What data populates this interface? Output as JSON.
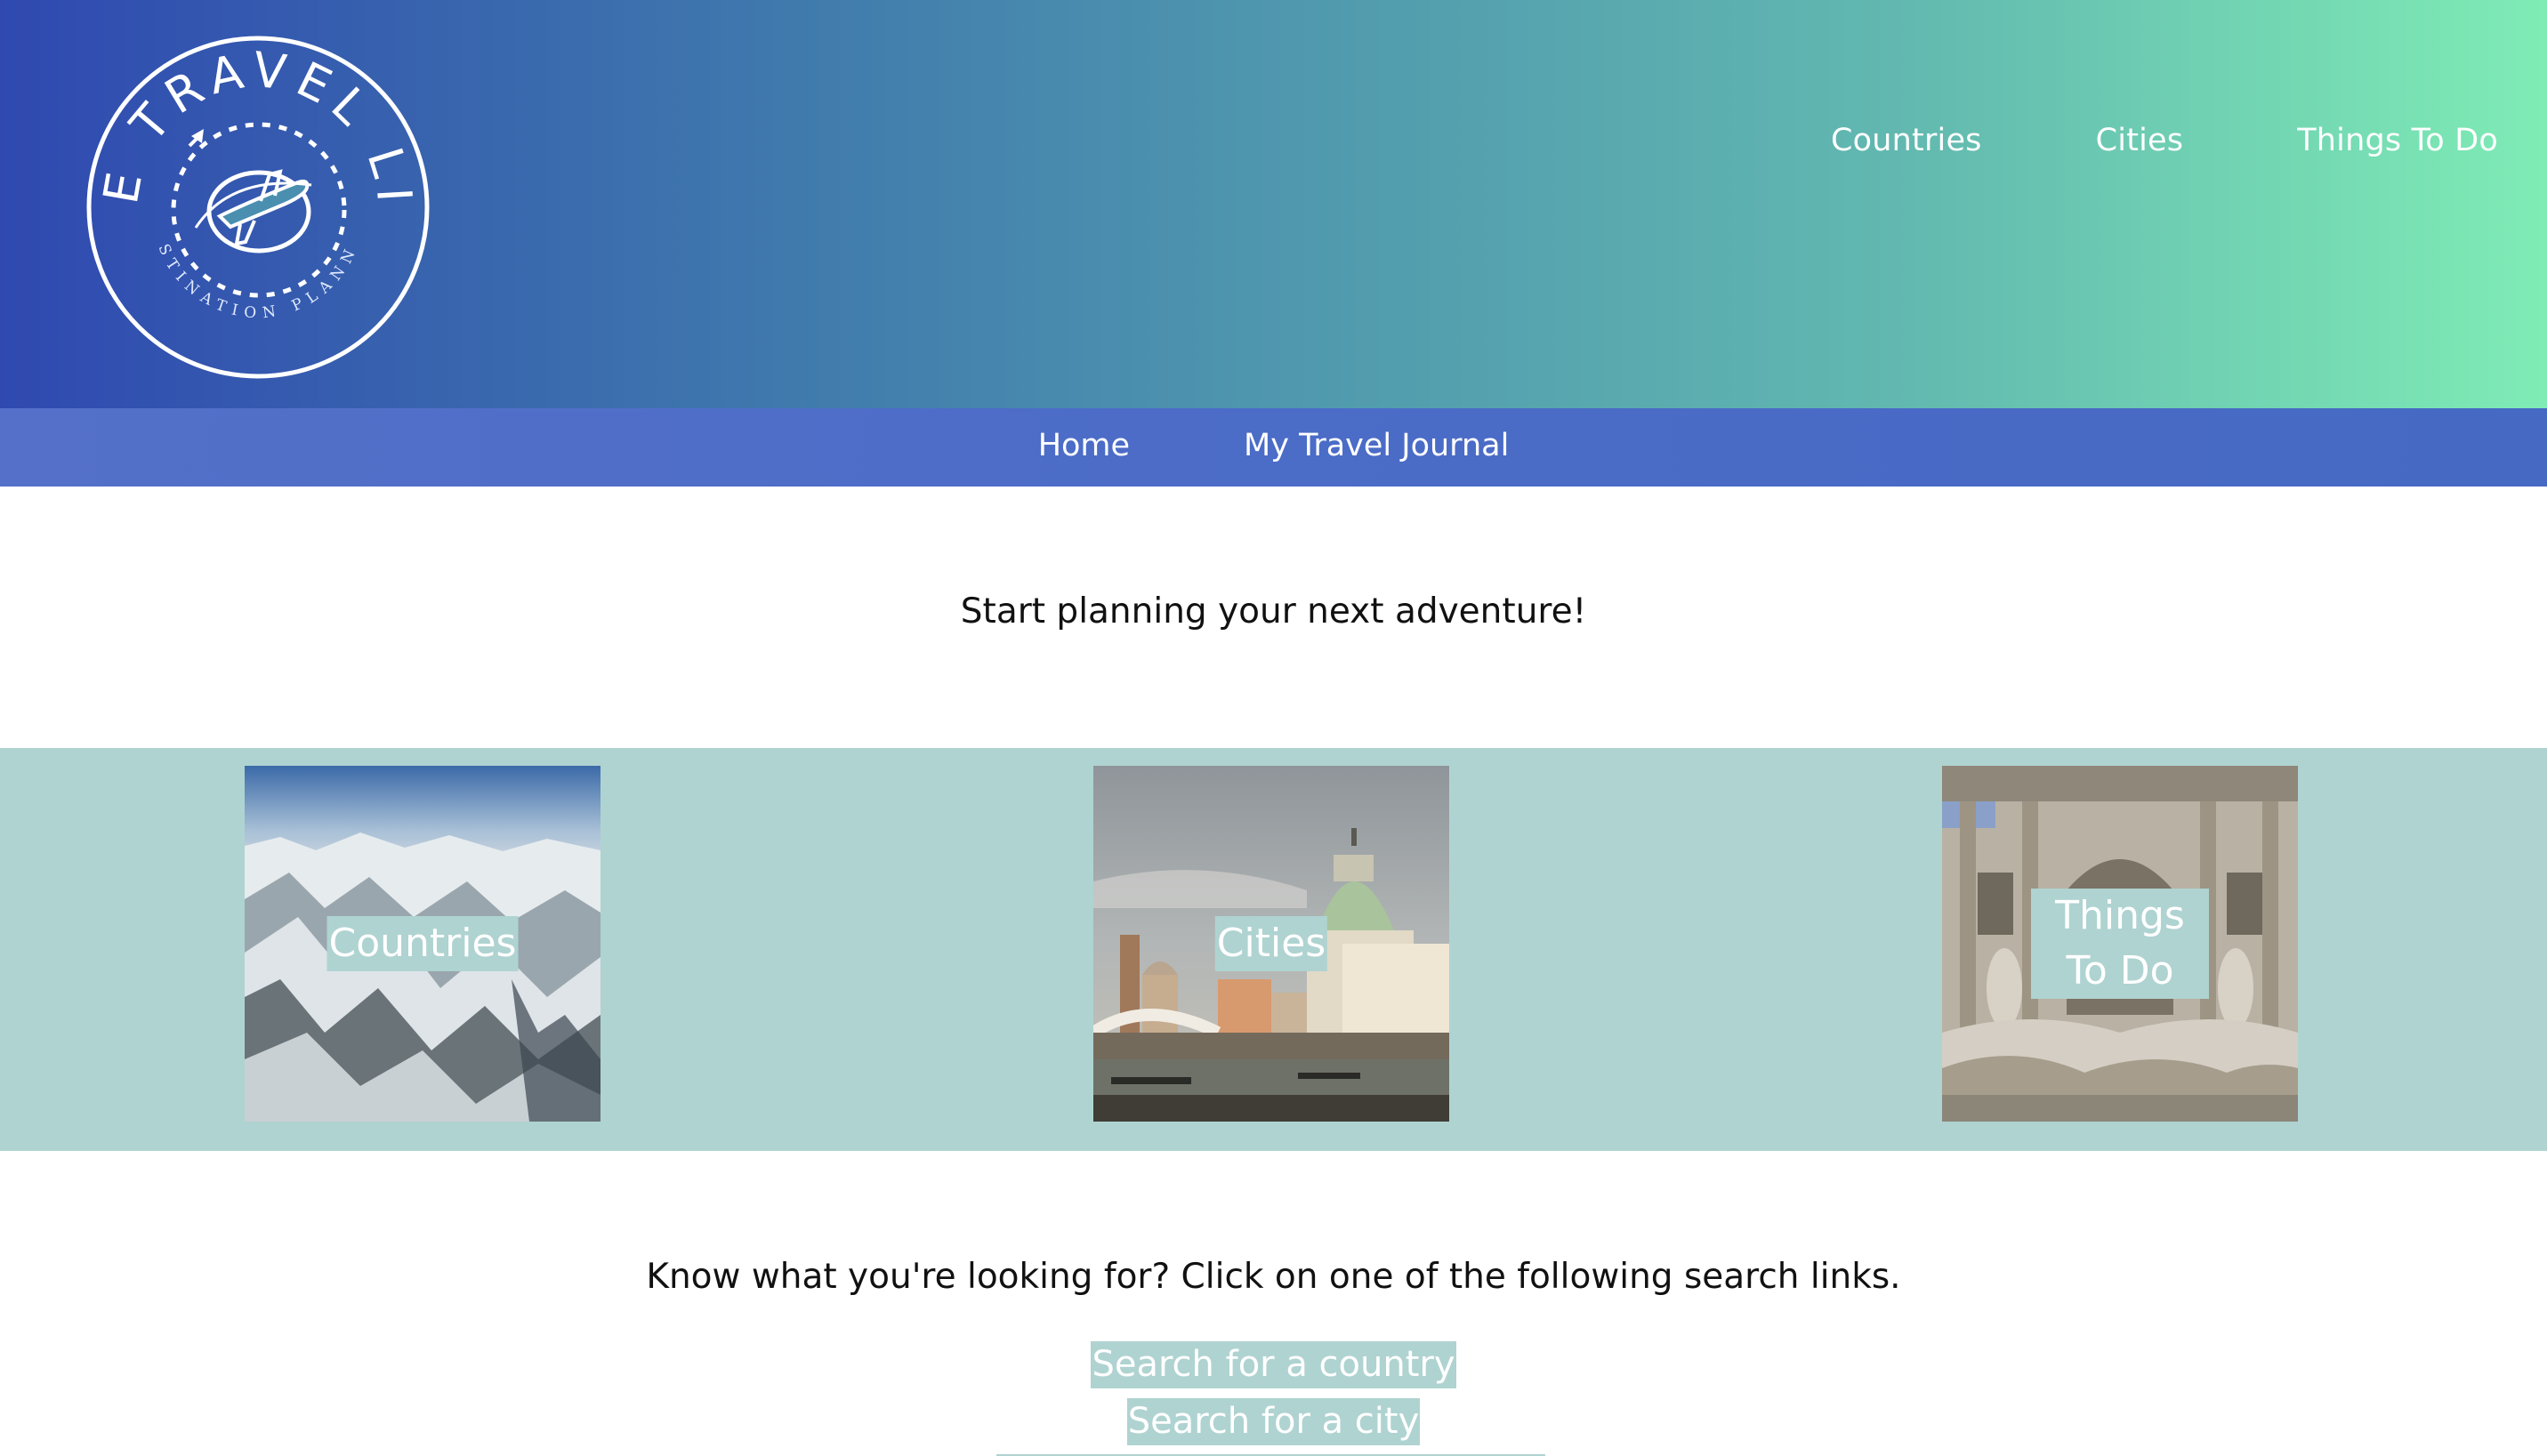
{
  "brand": {
    "logo_text": "THE TRAVEL LIST",
    "logo_subtext": "DESTINATION PLANNER"
  },
  "top_nav": [
    {
      "label": "Countries"
    },
    {
      "label": "Cities"
    },
    {
      "label": "Things To Do"
    }
  ],
  "sub_nav": [
    {
      "label": "Home"
    },
    {
      "label": "My Travel Journal"
    }
  ],
  "intro_text": "Start planning your next adventure!",
  "tiles": [
    {
      "label": "Countries",
      "image": "mountain-range-aerial"
    },
    {
      "label": "Cities",
      "image": "venice-canal-domes"
    },
    {
      "label": "Things To Do",
      "image": "trevi-fountain"
    }
  ],
  "search": {
    "prompt": "Know what you're looking for? Click on one of the following search links.",
    "links": [
      {
        "label": "Search for a country"
      },
      {
        "label": "Search for a city"
      }
    ]
  },
  "colors": {
    "header_gradient_start": "#2f49b0",
    "header_gradient_end": "#7fecb5",
    "subnav_bg": "#4b6cc7",
    "accent_teal": "#afd3d1"
  }
}
